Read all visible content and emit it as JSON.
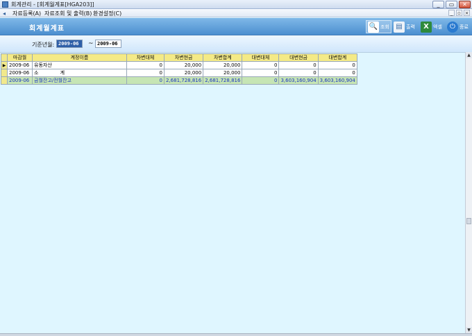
{
  "window": {
    "title": "회계관리 - [회계월계표[HGA203]]",
    "buttons": [
      "_",
      "▭",
      "✕"
    ]
  },
  "menu": {
    "items": [
      "자료등록(A)",
      "자료조회 및 출력(B)",
      "환경설정(C)"
    ],
    "mdi_buttons": [
      "_",
      "▫",
      "×"
    ]
  },
  "header": {
    "title": "회계월계표",
    "toolbar": {
      "search": "조회",
      "print": "출력",
      "excel": "엑셀",
      "exit": "종료"
    }
  },
  "filter": {
    "label": "기준년월:",
    "from": "2009-06",
    "tilde": "~",
    "to": "2009-06"
  },
  "grid": {
    "columns": [
      "마감월",
      "계정이름",
      "차변대체",
      "차변현금",
      "차변합계",
      "대변대체",
      "대변현금",
      "대변합계"
    ],
    "rows": [
      {
        "month": "2009-06",
        "account": "유동자산",
        "dr_transfer": "0",
        "dr_cash": "20,000",
        "dr_total": "20,000",
        "cr_transfer": "0",
        "cr_cash": "0",
        "cr_total": "0"
      },
      {
        "month": "2009-06",
        "account": "소              계",
        "dr_transfer": "0",
        "dr_cash": "20,000",
        "dr_total": "20,000",
        "cr_transfer": "0",
        "cr_cash": "0",
        "cr_total": "0"
      }
    ],
    "total": {
      "month": "2009-06",
      "account": "금월잔고/전월잔고",
      "dr_transfer": "0",
      "dr_cash": "2,681,728,816",
      "dr_total": "2,681,728,816",
      "cr_transfer": "0",
      "cr_cash": "3,603,160,904",
      "cr_total": "3,603,160,904"
    }
  },
  "colors": {
    "header_bg": "#4c8fd0",
    "grid_header": "#f4ea86",
    "total_row": "#c6e5b4",
    "total_text": "#1a34c0",
    "highlight": "#a9c8ee",
    "background": "#dff6ff"
  }
}
